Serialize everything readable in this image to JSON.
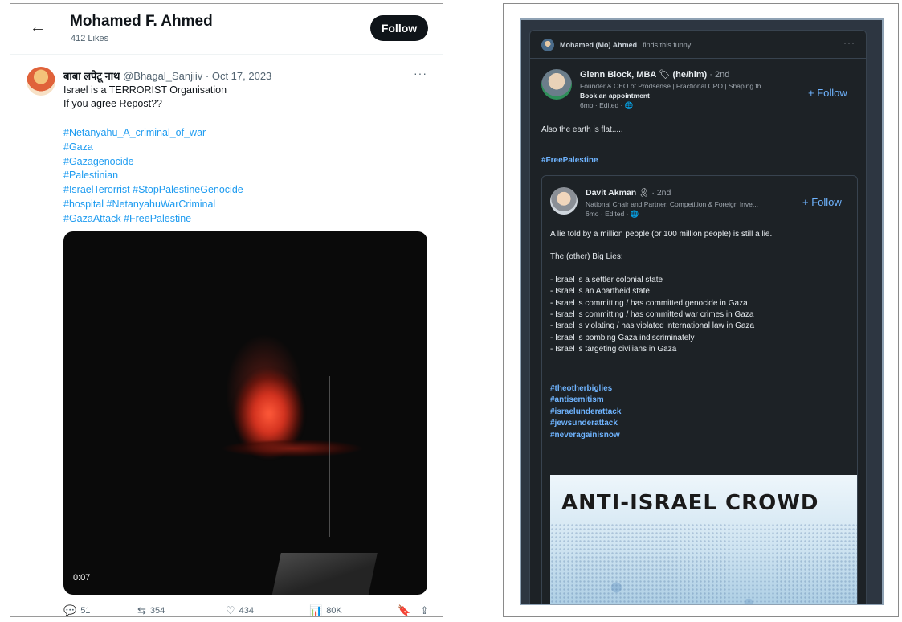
{
  "twitter": {
    "header": {
      "name": "Mohamed F. Ahmed",
      "likes": "412 Likes",
      "follow_label": "Follow"
    },
    "post": {
      "author_name": "बाबा लपेटू नाथ",
      "author_handle": "@Bhagal_Sanjiiv",
      "date": "· Oct 17, 2023",
      "text_line1": "Israel is a TERRORIST Organisation",
      "text_line2": "If you agree Repost??",
      "hashtags": [
        "#Netanyahu_A_criminal_of_war",
        "#Gaza",
        "#Gazagenocide",
        "#Palestinian",
        "#IsraelTerorrist #StopPalestineGenocide",
        "#hospital #NetanyahuWarCriminal",
        "#GazaAttack #FreePalestine"
      ],
      "video_time": "0:07"
    },
    "actions": {
      "replies": "51",
      "reposts": "354",
      "likes": "434",
      "views": "80K"
    }
  },
  "linkedin": {
    "reaction": {
      "name": "Mohamed (Mo) Ahmed",
      "suffix": "finds this funny"
    },
    "post": {
      "author_name": "Glenn Block, MBA",
      "pronouns": "(he/him)",
      "degree": "· 2nd",
      "headline": "Founder & CEO of Prodsense | Fractional CPO | Shaping th...",
      "link": "Book an appointment",
      "time": "6mo · Edited ·",
      "follow_label": "+ Follow",
      "text": "Also the earth is flat.....",
      "hashtag": "#FreePalestine"
    },
    "shared": {
      "author_name": "Davit Akman",
      "degree": "· 2nd",
      "headline": "National Chair and Partner, Competition & Foreign Inve...",
      "time": "6mo · Edited ·",
      "follow_label": "+ Follow",
      "line1": "A lie told by a million people (or 100 million people) is still a lie.",
      "line2": "The (other) Big Lies:",
      "bullets": [
        "- Israel is a settler colonial state",
        "- Israel is an Apartheid state",
        "- Israel is committing / has committed genocide in Gaza",
        "- Israel is committing / has committed war crimes in Gaza",
        "- Israel is violating / has violated international law in Gaza",
        "- Israel is bombing Gaza indiscriminately",
        "- Israel is targeting civilians in Gaza"
      ],
      "hashtags": [
        "#theotherbiglies",
        "#antisemitism",
        "#israelunderattack",
        "#jewsunderattack",
        "#neveragainisnow"
      ],
      "image_title": "ANTI-ISRAEL CROWD"
    }
  }
}
